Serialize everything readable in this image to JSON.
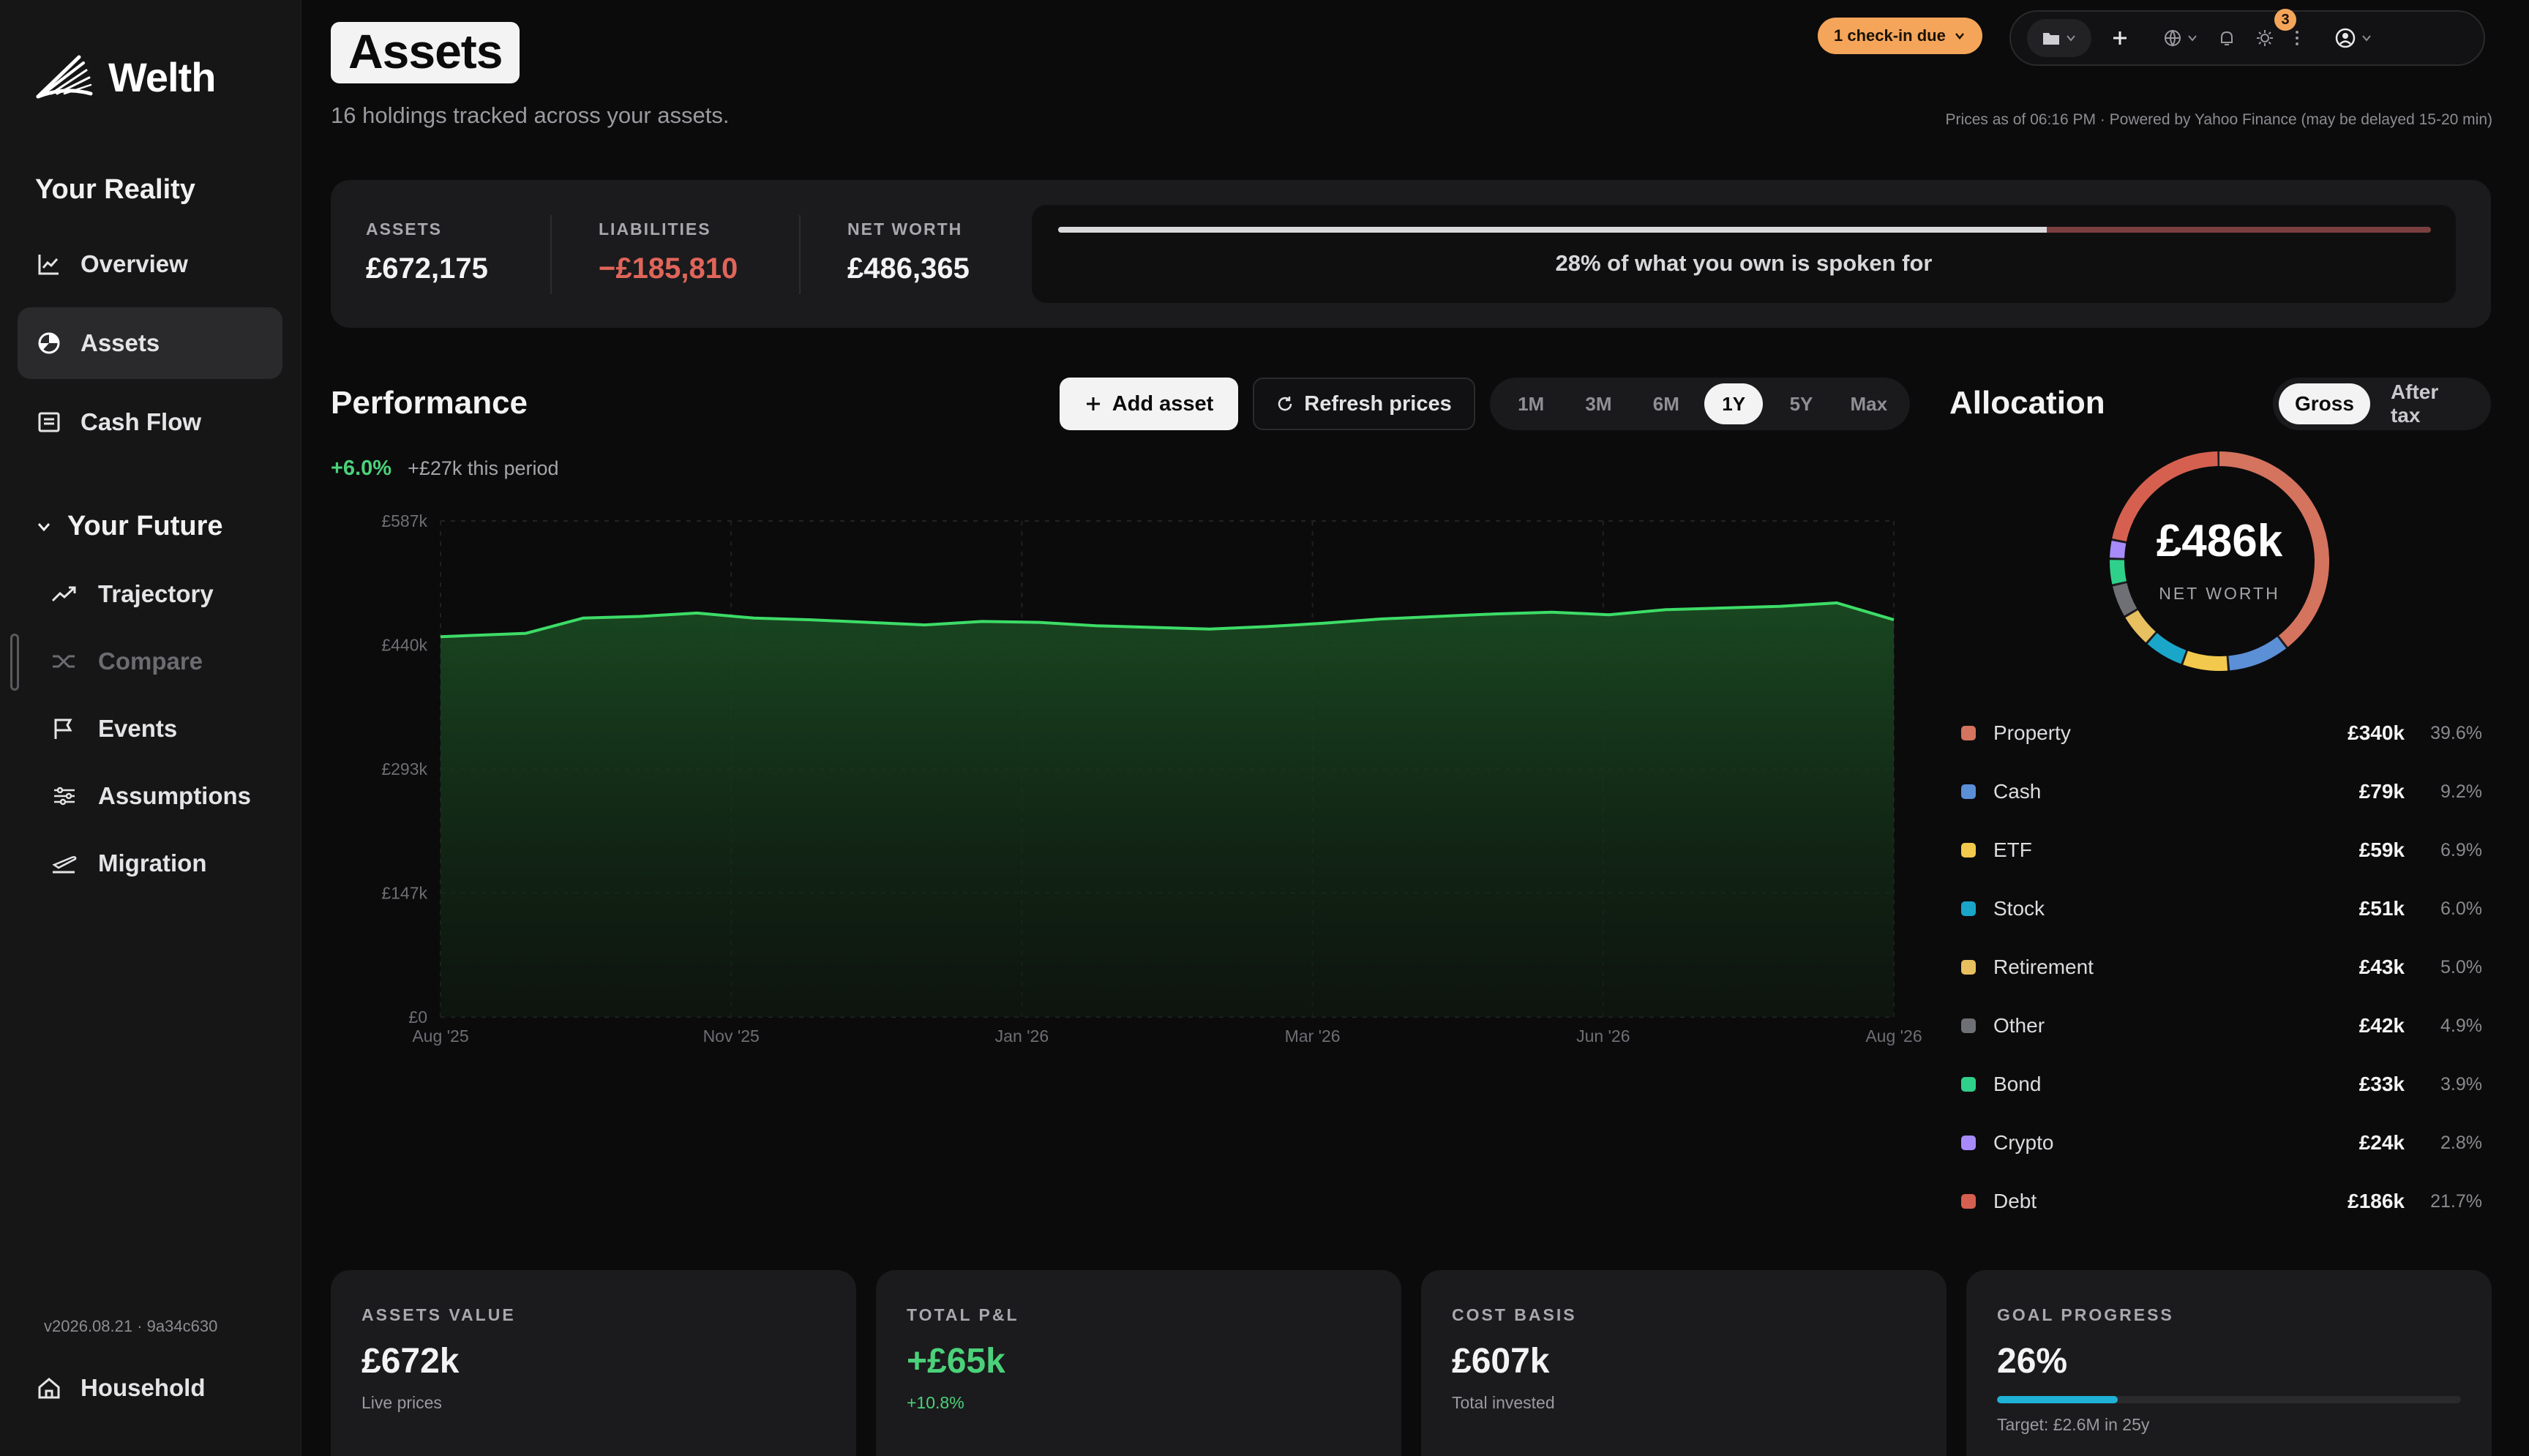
{
  "sidebar": {
    "brand": "Welth",
    "reality_heading": "Your Reality",
    "reality_items": [
      "Overview",
      "Assets",
      "Cash Flow"
    ],
    "future_heading": "Your Future",
    "future_items": [
      "Trajectory",
      "Compare",
      "Events",
      "Assumptions",
      "Migration"
    ],
    "version": "v2026.08.21 · 9a34c630",
    "household": "Household"
  },
  "header": {
    "title": "Assets",
    "subtitle": "16 holdings tracked across your assets.",
    "checkin": "1 check-in due",
    "notification_count": "3",
    "prices_note": "Prices as of 06:16 PM · Powered by Yahoo Finance (may be delayed 15-20 min)"
  },
  "summary": {
    "assets_label": "ASSETS",
    "assets_value": "£672,175",
    "liabilities_label": "LIABILITIES",
    "liabilities_value": "−£185,810",
    "net_worth_label": "NET WORTH",
    "net_worth_value": "£486,365",
    "spoken_for_text": "28% of what you own is spoken for",
    "spoken_for_fraction": 0.72
  },
  "performance": {
    "title": "Performance",
    "add_asset": "Add asset",
    "refresh_prices": "Refresh prices",
    "ranges": [
      "1M",
      "3M",
      "6M",
      "1Y",
      "5Y",
      "Max"
    ],
    "selected_range": "1Y",
    "change_pct": "+6.0%",
    "change_abs": "+£27k this period"
  },
  "chart_data": {
    "type": "area",
    "title": "",
    "xlabel": "",
    "ylabel": "",
    "y_ticks": [
      "£587k",
      "£440k",
      "£293k",
      "£147k",
      "£0"
    ],
    "x_ticks": [
      "Aug '25",
      "Nov '25",
      "Jan '26",
      "Mar '26",
      "Jun '26",
      "Aug '26"
    ],
    "ylim": [
      0,
      587
    ],
    "y_unit": "£k",
    "x_index": [
      0,
      3,
      5,
      7,
      9,
      11,
      13,
      15,
      17,
      19,
      21,
      23,
      25,
      27,
      29,
      31,
      33,
      35,
      37,
      39,
      41,
      43,
      45,
      47,
      49,
      51
    ],
    "values": [
      450,
      454,
      472,
      474,
      478,
      472,
      470,
      467,
      464,
      468,
      467,
      463,
      461,
      459,
      462,
      466,
      471,
      474,
      477,
      479,
      476,
      482,
      484,
      486,
      490,
      470
    ],
    "grid": true,
    "line_color": "#3ddc67"
  },
  "allocation": {
    "title": "Allocation",
    "toggle": [
      "Gross",
      "After tax"
    ],
    "selected_toggle": "Gross",
    "center_value": "£486k",
    "center_label": "NET WORTH",
    "items": [
      {
        "name": "Property",
        "value": "£340k",
        "pct": "39.6%",
        "share": 39.6,
        "color": "#d4735e"
      },
      {
        "name": "Cash",
        "value": "£79k",
        "pct": "9.2%",
        "share": 9.2,
        "color": "#5b8fd6"
      },
      {
        "name": "ETF",
        "value": "£59k",
        "pct": "6.9%",
        "share": 6.9,
        "color": "#f2c94c"
      },
      {
        "name": "Stock",
        "value": "£51k",
        "pct": "6.0%",
        "share": 6.0,
        "color": "#1aa6c9"
      },
      {
        "name": "Retirement",
        "value": "£43k",
        "pct": "5.0%",
        "share": 5.0,
        "color": "#e8c060"
      },
      {
        "name": "Other",
        "value": "£42k",
        "pct": "4.9%",
        "share": 4.9,
        "color": "#6f7076"
      },
      {
        "name": "Bond",
        "value": "£33k",
        "pct": "3.9%",
        "share": 3.9,
        "color": "#2fd08a"
      },
      {
        "name": "Crypto",
        "value": "£24k",
        "pct": "2.8%",
        "share": 2.8,
        "color": "#a78bfa"
      },
      {
        "name": "Debt",
        "value": "£186k",
        "pct": "21.7%",
        "share": 21.7,
        "color": "#d6604f"
      }
    ]
  },
  "cards": [
    {
      "label": "ASSETS VALUE",
      "value": "£672k",
      "sub": "Live prices"
    },
    {
      "label": "TOTAL P&L",
      "value": "+£65k",
      "sub": "+10.8%"
    },
    {
      "label": "COST BASIS",
      "value": "£607k",
      "sub": "Total invested"
    },
    {
      "label": "GOAL PROGRESS",
      "value": "26%",
      "sub": "Target: £2.6M in 25y",
      "progress": 0.26
    }
  ]
}
